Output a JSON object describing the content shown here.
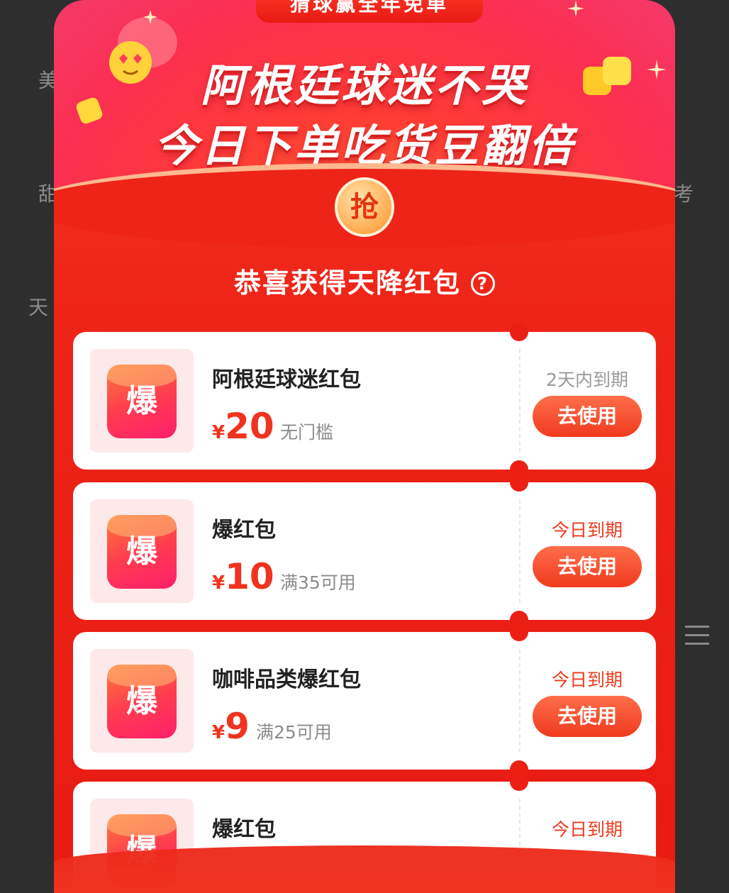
{
  "modal": {
    "top_tab": "猜球赢全年免单",
    "headline_1": "阿根廷球迷不哭",
    "headline_2": "今日下单吃货豆翻倍",
    "grab_badge": "抢",
    "section_title": "恭喜获得天降红包",
    "help_symbol": "?"
  },
  "background": {
    "left_texts": [
      "美",
      "甜",
      "天"
    ],
    "right_text": "考"
  },
  "coupons": [
    {
      "icon_text": "爆",
      "name": "阿根廷球迷红包",
      "currency": "¥",
      "amount": "20",
      "condition": "无门槛",
      "expire": "2天内到期",
      "button": "去使用"
    },
    {
      "icon_text": "爆",
      "name": "爆红包",
      "currency": "¥",
      "amount": "10",
      "condition": "满35可用",
      "expire": "今日到期",
      "button": "去使用"
    },
    {
      "icon_text": "爆",
      "name": "咖啡品类爆红包",
      "currency": "¥",
      "amount": "9",
      "condition": "满25可用",
      "expire": "今日到期",
      "button": "去使用"
    },
    {
      "icon_text": "爆",
      "name": "爆红包",
      "expire": "今日到期"
    }
  ],
  "colors": {
    "accent": "#f0331f",
    "modal_bg": "#ee2418",
    "header_pink": "#fb2f53"
  }
}
